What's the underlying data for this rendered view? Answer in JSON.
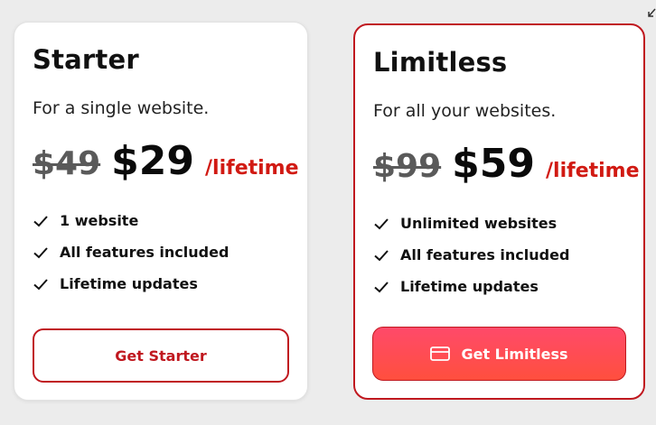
{
  "plans": [
    {
      "title": "Starter",
      "subtitle": "For a single website.",
      "old_price": "$49",
      "price": "$29",
      "period": "/lifetime",
      "features": [
        "1 website",
        "All features included",
        "Lifetime updates"
      ],
      "button_label": "Get Starter",
      "icons": {
        "feature": "check-icon"
      }
    },
    {
      "title": "Limitless",
      "subtitle": "For all your websites.",
      "old_price": "$99",
      "price": "$59",
      "period": "/lifetime",
      "features": [
        "Unlimited websites",
        "All features included",
        "Lifetime updates"
      ],
      "button_label": "Get Limitless",
      "icons": {
        "feature": "check-icon",
        "button": "credit-card-icon"
      }
    }
  ],
  "colors": {
    "accent": "#c0181f",
    "period": "#d11a13",
    "button_gradient_top": "#ff4a6a",
    "button_gradient_bottom": "#ff4f3e",
    "background": "#ececec"
  }
}
